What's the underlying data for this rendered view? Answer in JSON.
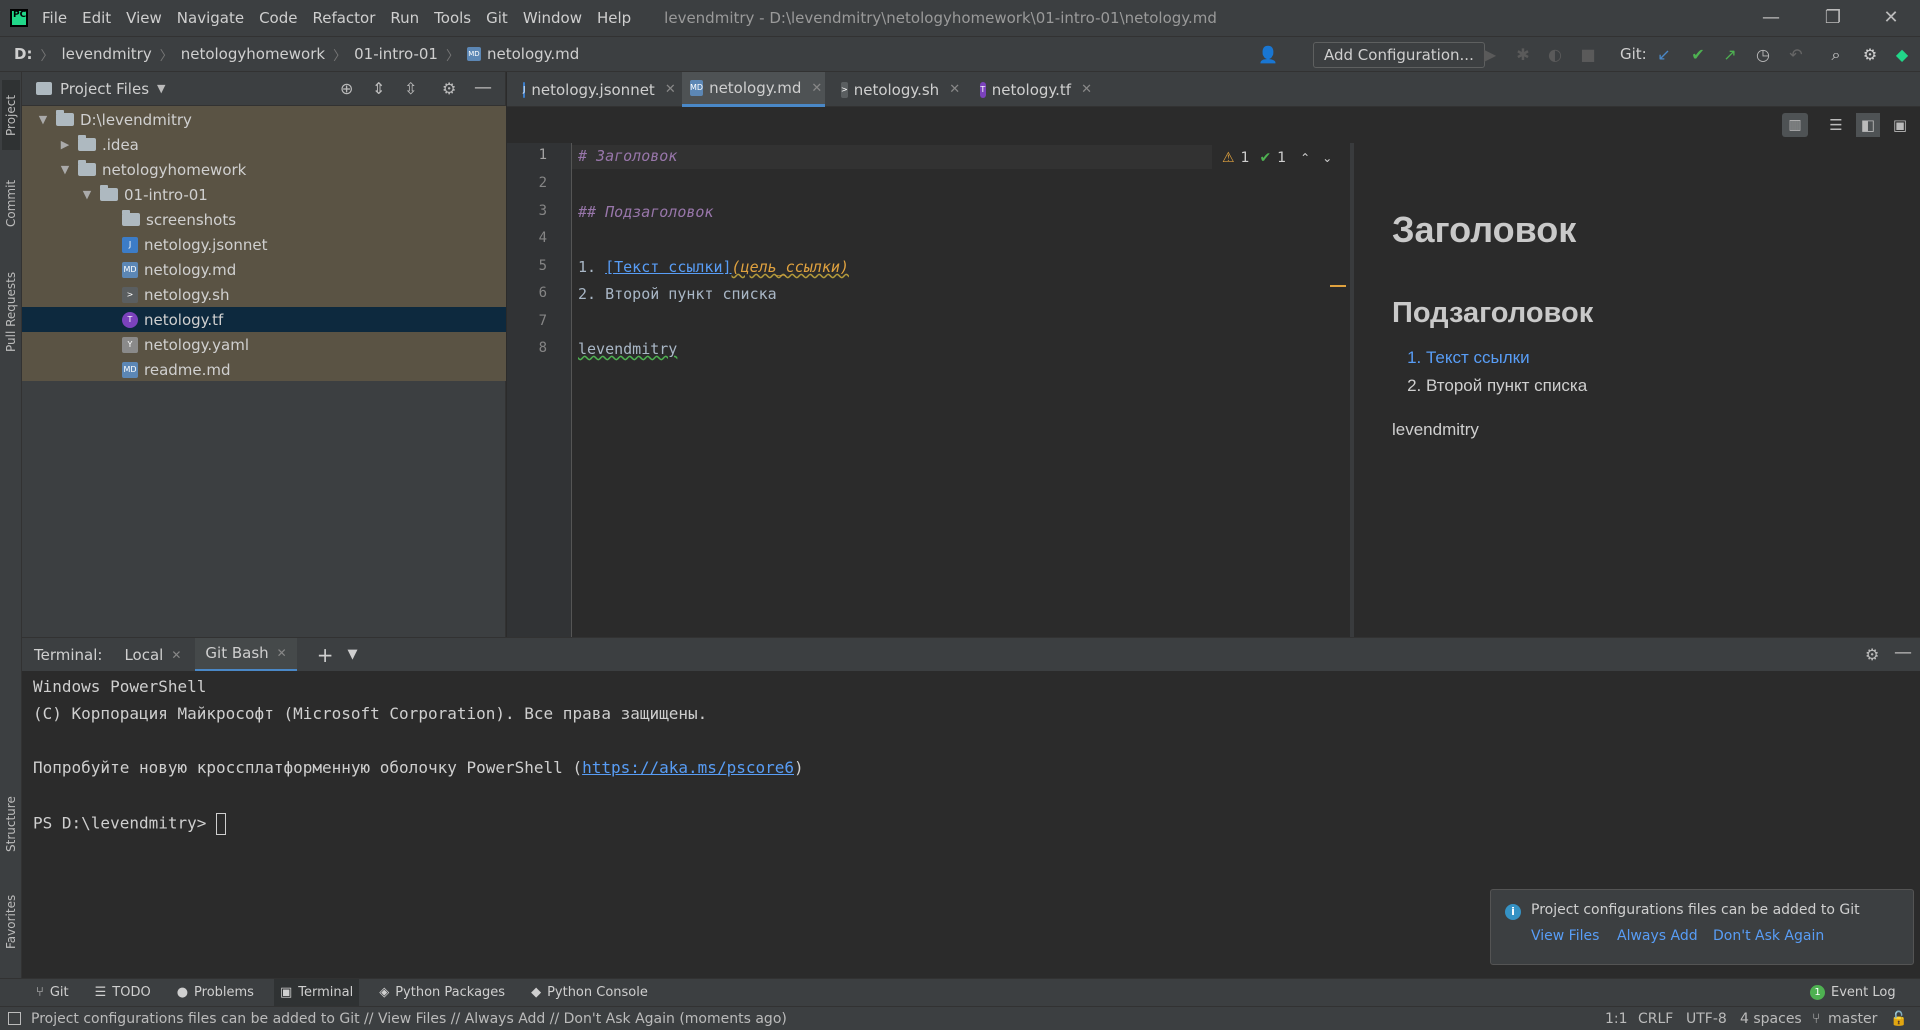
{
  "menu": {
    "items": [
      "File",
      "Edit",
      "View",
      "Navigate",
      "Code",
      "Refactor",
      "Run",
      "Tools",
      "Git",
      "Window",
      "Help"
    ],
    "window_title": "levendmitry - D:\\levendmitry\\netologyhomework\\01-intro-01\\netology.md"
  },
  "navbar": {
    "drive": "D:",
    "crumbs": [
      "levendmitry",
      "netologyhomework",
      "01-intro-01",
      "netology.md"
    ],
    "add_configuration": "Add Configuration...",
    "git_label": "Git:"
  },
  "left_stripe": {
    "project": "Project",
    "commit": "Commit",
    "pull_requests": "Pull Requests",
    "structure": "Structure",
    "favorites": "Favorites"
  },
  "project": {
    "title": "Project Files",
    "tree": [
      {
        "label": "D:\\levendmitry",
        "kind": "folder",
        "depth": 0,
        "expanded": true
      },
      {
        "label": ".idea",
        "kind": "folder",
        "depth": 1,
        "expanded": false
      },
      {
        "label": "netologyhomework",
        "kind": "folder",
        "depth": 1,
        "expanded": true
      },
      {
        "label": "01-intro-01",
        "kind": "folder",
        "depth": 2,
        "expanded": true
      },
      {
        "label": "screenshots",
        "kind": "folder",
        "depth": 3
      },
      {
        "label": "netology.jsonnet",
        "kind": "jsonnet",
        "depth": 3
      },
      {
        "label": "netology.md",
        "kind": "md",
        "depth": 3
      },
      {
        "label": "netology.sh",
        "kind": "sh",
        "depth": 3
      },
      {
        "label": "netology.tf",
        "kind": "tf",
        "depth": 3,
        "selected": true
      },
      {
        "label": "netology.yaml",
        "kind": "yaml",
        "depth": 3
      },
      {
        "label": "readme.md",
        "kind": "md",
        "depth": 3
      }
    ]
  },
  "editor_tabs": [
    {
      "label": "netology.jsonnet",
      "kind": "jsonnet"
    },
    {
      "label": "netology.md",
      "kind": "md",
      "active": true
    },
    {
      "label": "netology.sh",
      "kind": "sh"
    },
    {
      "label": "netology.tf",
      "kind": "tf"
    }
  ],
  "editor": {
    "line_numbers": [
      "1",
      "2",
      "3",
      "4",
      "5",
      "6",
      "7",
      "8"
    ],
    "lines": {
      "l1": "# Заголовок",
      "l3": "## Подзаголовок",
      "l5_num": "1. ",
      "l5_link": "[Текст ссылки]",
      "l5_target": "(цель_ссылки)",
      "l6": "2. Второй пункт списка",
      "l8": "levendmitry"
    },
    "warnings": "1",
    "weak_warnings": "1"
  },
  "preview": {
    "h1": "Заголовок",
    "h2": "Подзаголовок",
    "list": [
      "Текст ссылки",
      "Второй пункт списка"
    ],
    "para": "levendmitry"
  },
  "terminal": {
    "label": "Terminal:",
    "tabs": [
      "Local",
      "Git Bash"
    ],
    "lines": {
      "t1": "Windows PowerShell",
      "t2": "(C) Корпорация Майкрософт (Microsoft Corporation). Все права защищены.",
      "t3_pre": "Попробуйте новую кроссплатформенную оболочку PowerShell (",
      "t3_link": "https://aka.ms/pscore6",
      "t3_post": ")",
      "prompt": "PS D:\\levendmitry> "
    }
  },
  "notification": {
    "message": "Project configurations files can be added to Git",
    "actions": [
      "View Files",
      "Always Add",
      "Don't Ask Again"
    ]
  },
  "tool_strip": {
    "tabs": [
      "Git",
      "TODO",
      "Problems",
      "Terminal",
      "Python Packages",
      "Python Console"
    ],
    "event_log": "Event Log",
    "event_count": "1"
  },
  "status": {
    "message": "Project configurations files can be added to Git // View Files // Always Add // Don't Ask Again (moments ago)",
    "position": "1:1",
    "line_sep": "CRLF",
    "encoding": "UTF-8",
    "indent": "4 spaces",
    "branch": "master"
  },
  "colors": {
    "accent": "#4a88c7",
    "link": "#589df6",
    "heading": "#9876aa",
    "warning": "#e0a23f",
    "ok": "#4eb151"
  }
}
